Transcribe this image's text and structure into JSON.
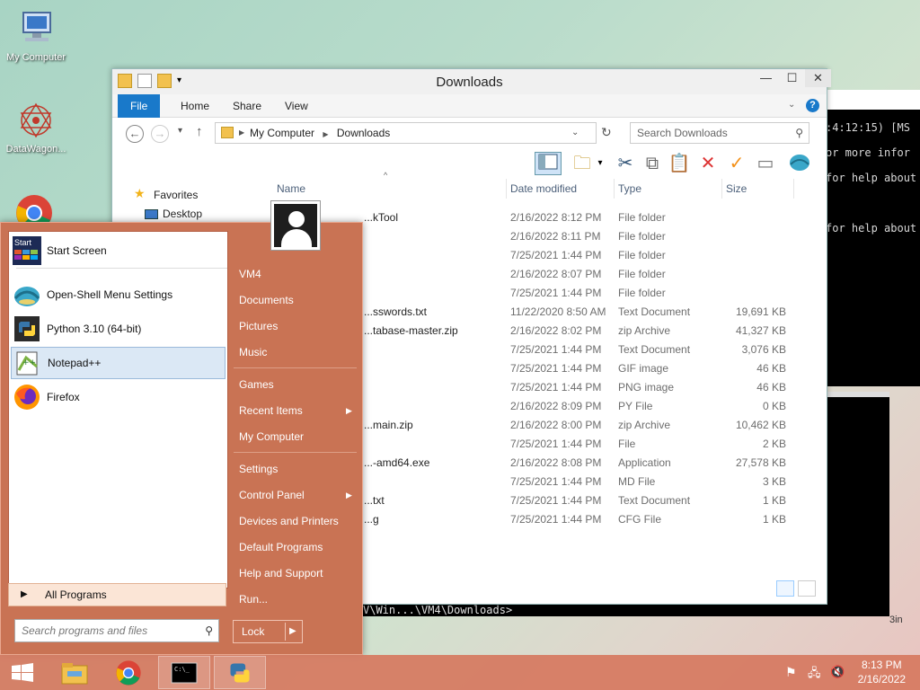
{
  "desktop": {
    "icons": [
      {
        "label": "My Computer"
      },
      {
        "label": "DataWagon..."
      }
    ]
  },
  "console": {
    "lines": [
      ":4:12:15) [MS",
      "or more infor",
      "for help about",
      "",
      "for help about"
    ],
    "bottom_line": "V\\Win...\\VM4\\Downloads>",
    "corner_text": "3in"
  },
  "explorer": {
    "title": "Downloads",
    "tabs": [
      "File",
      "Home",
      "Share",
      "View"
    ],
    "breadcrumb": [
      "My Computer",
      "Downloads"
    ],
    "search_placeholder": "Search Downloads",
    "nav": {
      "favorites": "Favorites",
      "desktop": "Desktop"
    },
    "columns": {
      "name": "Name",
      "date": "Date modified",
      "type": "Type",
      "size": "Size"
    },
    "files": [
      {
        "name": "...kTool",
        "date": "2/16/2022 8:12 PM",
        "type": "File folder",
        "size": ""
      },
      {
        "name": "",
        "date": "2/16/2022 8:11 PM",
        "type": "File folder",
        "size": ""
      },
      {
        "name": "",
        "date": "7/25/2021 1:44 PM",
        "type": "File folder",
        "size": ""
      },
      {
        "name": "",
        "date": "2/16/2022 8:07 PM",
        "type": "File folder",
        "size": ""
      },
      {
        "name": "",
        "date": "7/25/2021 1:44 PM",
        "type": "File folder",
        "size": ""
      },
      {
        "name": "...sswords.txt",
        "date": "11/22/2020 8:50 AM",
        "type": "Text Document",
        "size": "19,691 KB"
      },
      {
        "name": "...tabase-master.zip",
        "date": "2/16/2022 8:02 PM",
        "type": "zip Archive",
        "size": "41,327 KB"
      },
      {
        "name": "",
        "date": "7/25/2021 1:44 PM",
        "type": "Text Document",
        "size": "3,076 KB"
      },
      {
        "name": "",
        "date": "7/25/2021 1:44 PM",
        "type": "GIF image",
        "size": "46 KB"
      },
      {
        "name": "",
        "date": "7/25/2021 1:44 PM",
        "type": "PNG image",
        "size": "46 KB"
      },
      {
        "name": "",
        "date": "2/16/2022 8:09 PM",
        "type": "PY File",
        "size": "0 KB"
      },
      {
        "name": "...main.zip",
        "date": "2/16/2022 8:00 PM",
        "type": "zip Archive",
        "size": "10,462 KB"
      },
      {
        "name": "",
        "date": "7/25/2021 1:44 PM",
        "type": "File",
        "size": "2 KB"
      },
      {
        "name": "...-amd64.exe",
        "date": "2/16/2022 8:08 PM",
        "type": "Application",
        "size": "27,578 KB"
      },
      {
        "name": "",
        "date": "7/25/2021 1:44 PM",
        "type": "MD File",
        "size": "3 KB"
      },
      {
        "name": "...txt",
        "date": "7/25/2021 1:44 PM",
        "type": "Text Document",
        "size": "1 KB"
      },
      {
        "name": "...g",
        "date": "7/25/2021 1:44 PM",
        "type": "CFG File",
        "size": "1 KB"
      }
    ]
  },
  "startmenu": {
    "programs": [
      {
        "label": "Start Screen"
      },
      {
        "label": "Open-Shell Menu Settings"
      },
      {
        "label": "Python 3.10 (64-bit)"
      },
      {
        "label": "Notepad++"
      },
      {
        "label": "Firefox"
      }
    ],
    "all_programs": "All Programs",
    "search_placeholder": "Search programs and files",
    "links": [
      "VM4",
      "Documents",
      "Pictures",
      "Music",
      "Games",
      "Recent Items",
      "My Computer",
      "Settings",
      "Control Panel",
      "Devices and Printers",
      "Default Programs",
      "Help and Support",
      "Run..."
    ],
    "lock": "Lock",
    "start_screen_tile": "Start"
  },
  "taskbar": {
    "time": "8:13 PM",
    "date": "2/16/2022"
  },
  "colors": {
    "accent": "#1979ca",
    "startmenu": "#c97354",
    "taskbar": "#d6785f"
  }
}
